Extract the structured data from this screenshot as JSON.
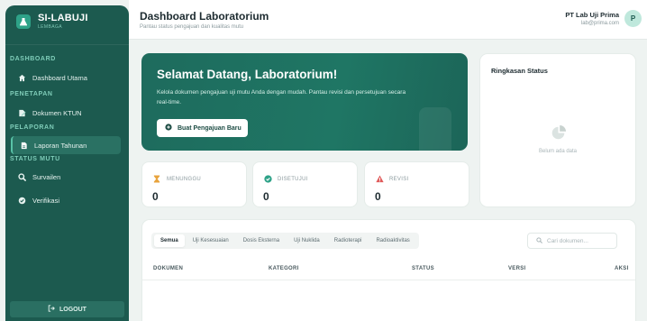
{
  "brand": {
    "name": "SI-LABUJI",
    "sub": "LEMBAGA",
    "logo": "lab-flask-icon"
  },
  "sidebar": {
    "sections": [
      {
        "label": "DASHBOARD"
      },
      {
        "label": "PENETAPAN"
      },
      {
        "label": "PELAPORAN"
      },
      {
        "label": "STATUS MUTU"
      }
    ],
    "items": [
      {
        "label": "Dashboard Utama",
        "icon": "home-icon"
      },
      {
        "label": "Dokumen KTUN",
        "icon": "document-edit-icon"
      },
      {
        "label": "Laporan Tahunan",
        "icon": "report-icon",
        "active": true
      },
      {
        "label": "Survailen",
        "icon": "search-icon"
      },
      {
        "label": "Verifikasi",
        "icon": "check-circle-icon"
      }
    ],
    "logout": "LOGOUT"
  },
  "header": {
    "title": "Dashboard Laboratorium",
    "subtitle": "Pantau status pengajuan dan kualitas mutu",
    "user_name": "PT Lab Uji Prima",
    "user_email": "lab@prima.com",
    "avatar": "P"
  },
  "welcome": {
    "title": "Selamat Datang, Laboratorium!",
    "text": "Kelola dokumen pengajuan uji mutu Anda dengan mudah. Pantau revisi dan persetujuan secara real-time.",
    "button": "Buat Pengajuan Baru"
  },
  "ringkasan": {
    "title": "Ringkasan Status",
    "empty": "Belum ada data"
  },
  "stats": [
    {
      "label": "MENUNGGU",
      "value": "0",
      "icon": "hourglass-icon",
      "color": "#e8a33c"
    },
    {
      "label": "DISETUJUI",
      "value": "0",
      "icon": "check-circle-icon",
      "color": "#2ea288"
    },
    {
      "label": "REVISI",
      "value": "0",
      "icon": "warning-icon",
      "color": "#e05a5a"
    }
  ],
  "docs": {
    "tabs": [
      "Semua",
      "Uji Kesesuaian",
      "Dosis Eksterna",
      "Uji Nuklida",
      "Radioterapi",
      "Radioaktivitas"
    ],
    "active_tab": "Semua",
    "search_placeholder": "Cari dokumen...",
    "columns": [
      "DOKUMEN",
      "KATEGORI",
      "STATUS",
      "VERSI",
      "AKSI"
    ]
  },
  "colors": {
    "sidebar": "#1c5a4f",
    "accent": "#2ea288",
    "welcome": "#1f7664"
  }
}
